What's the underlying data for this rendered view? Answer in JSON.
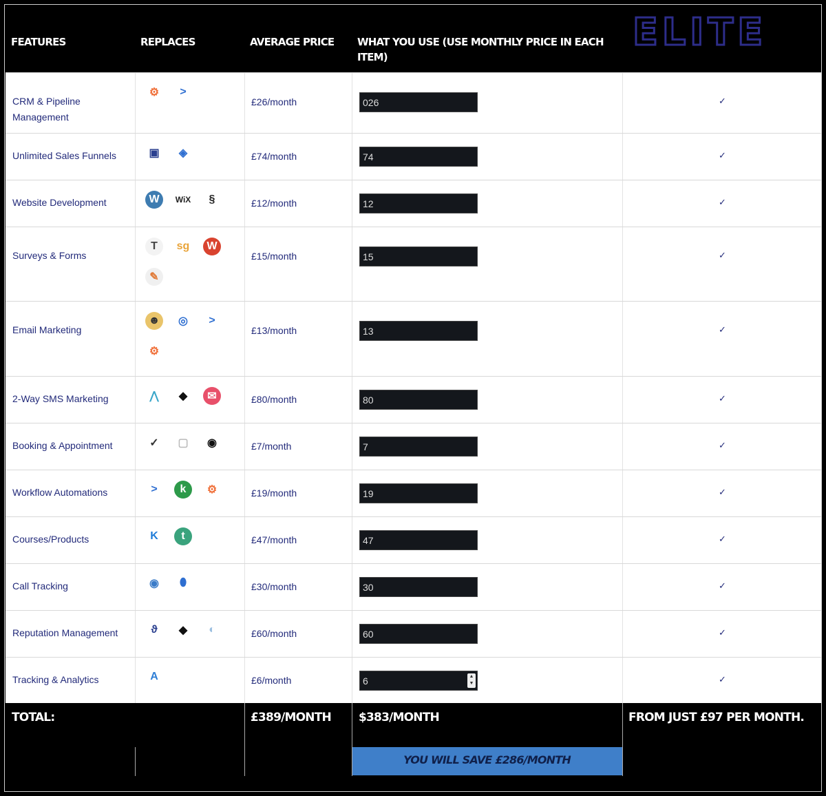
{
  "header": {
    "features": "Features",
    "replaces": "Replaces",
    "average_price": "Average Price",
    "what_you_use": "What you use (use monthly price in each item)",
    "brand": "ELITE"
  },
  "rows": [
    {
      "feature": "CRM & Pipeline Management",
      "price": "£26/month",
      "input": "026",
      "check": "✓",
      "icons": [
        "hubspot-icon",
        "arrow-chevron-icon"
      ]
    },
    {
      "feature": "Unlimited Sales Funnels",
      "price": "£74/month",
      "input": "74",
      "check": "✓",
      "icons": [
        "clickfunnels-icon",
        "layers-icon"
      ]
    },
    {
      "feature": "Website Development",
      "price": "£12/month",
      "input": "12",
      "check": "✓",
      "icons": [
        "wordpress-icon",
        "wix-icon",
        "squarespace-icon"
      ]
    },
    {
      "feature": "Surveys & Forms",
      "price": "£15/month",
      "input": "15",
      "check": "✓",
      "icons": [
        "typeform-icon",
        "surveygizmo-icon",
        "wufoo-icon",
        "jotform-icon"
      ]
    },
    {
      "feature": "Email Marketing",
      "price": "£13/month",
      "input": "13",
      "check": "✓",
      "icons": [
        "mailchimp-icon",
        "constant-contact-icon",
        "activecampaign-icon",
        "hubspot-icon"
      ]
    },
    {
      "feature": "2-Way SMS Marketing",
      "price": "£80/month",
      "input": "80",
      "check": "✓",
      "icons": [
        "chevrons-up-icon",
        "podium-icon",
        "envelope-icon"
      ]
    },
    {
      "feature": "Booking & Appointment",
      "price": "£7/month",
      "input": "7",
      "check": "✓",
      "icons": [
        "checkmark-circle-icon",
        "calendar-icon",
        "acuity-icon"
      ]
    },
    {
      "feature": "Workflow Automations",
      "price": "£19/month",
      "input": "19",
      "check": "✓",
      "icons": [
        "activecampaign-icon",
        "keap-icon",
        "hubspot-icon"
      ]
    },
    {
      "feature": "Courses/Products",
      "price": "£47/month",
      "input": "47",
      "check": "✓",
      "icons": [
        "kajabi-icon",
        "teachable-icon"
      ]
    },
    {
      "feature": "Call Tracking",
      "price": "£30/month",
      "input": "30",
      "check": "✓",
      "icons": [
        "callrail-icon",
        "map-pin-icon"
      ]
    },
    {
      "feature": "Reputation Management",
      "price": "£60/month",
      "input": "60",
      "check": "✓",
      "icons": [
        "birdeye-icon",
        "podium-icon",
        "globe-icon"
      ]
    },
    {
      "feature": "Tracking & Analytics",
      "price": "£6/month",
      "input": "6",
      "check": "✓",
      "icons": [
        "google-analytics-icon"
      ]
    }
  ],
  "footer": {
    "total_label": "Total:",
    "avg_total": "£389/month",
    "your_total": "$383/month",
    "save_text": "You will save £286/month",
    "elite_price": "From just £97 per month."
  },
  "colors": {
    "text_blue": "#222a7a",
    "save_bar": "#3f7fc9",
    "input_bg": "#14171c",
    "brand_outline": "#2d2d8a"
  }
}
